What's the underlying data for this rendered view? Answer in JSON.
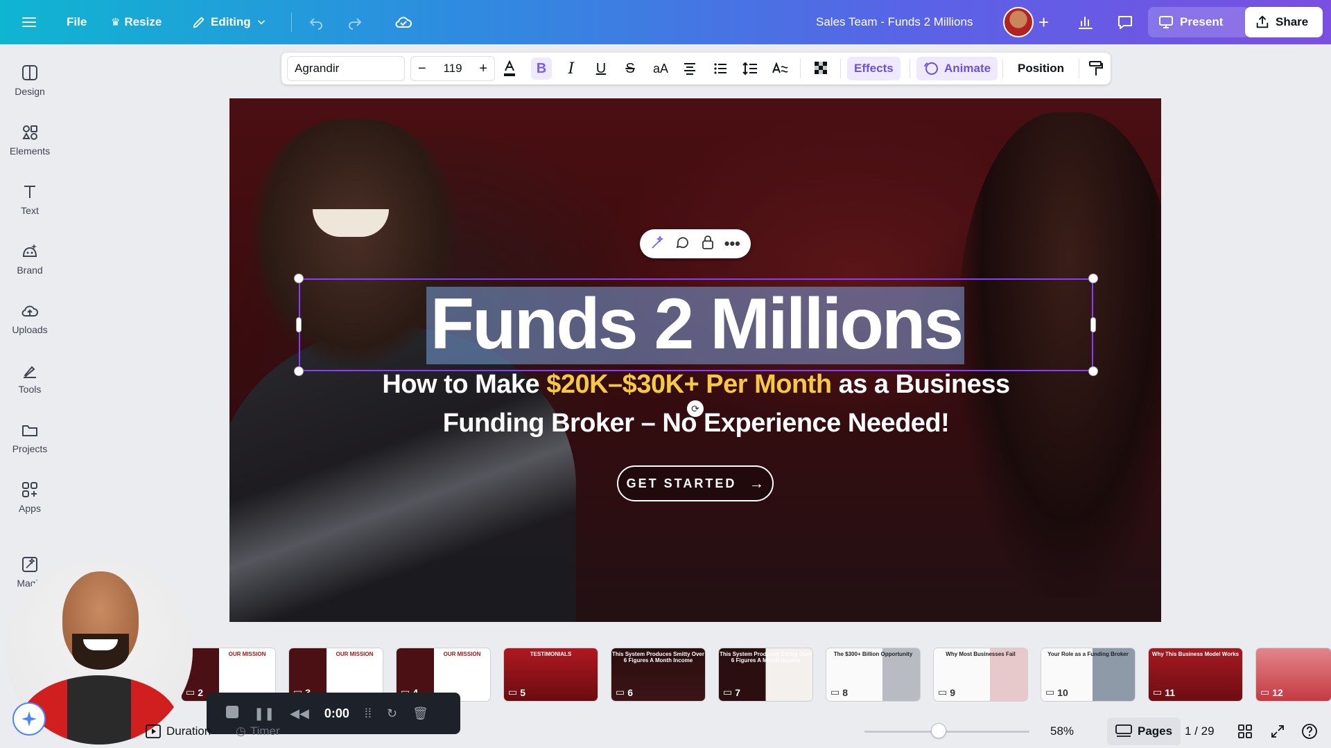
{
  "topbar": {
    "file_label": "File",
    "resize_label": "Resize",
    "editing_label": "Editing",
    "doc_title": "Sales Team - Funds 2 Millions",
    "present_label": "Present",
    "share_label": "Share"
  },
  "rail": {
    "items": [
      {
        "label": "Design",
        "icon": "design-icon"
      },
      {
        "label": "Elements",
        "icon": "elements-icon"
      },
      {
        "label": "Text",
        "icon": "text-icon"
      },
      {
        "label": "Brand",
        "icon": "brand-icon"
      },
      {
        "label": "Uploads",
        "icon": "uploads-icon"
      },
      {
        "label": "Tools",
        "icon": "tools-icon"
      },
      {
        "label": "Projects",
        "icon": "projects-icon"
      },
      {
        "label": "Apps",
        "icon": "apps-icon"
      },
      {
        "label": "Magic",
        "icon": "magic-icon"
      }
    ]
  },
  "format_toolbar": {
    "font_name": "Agrandir",
    "font_size": "119",
    "effects_label": "Effects",
    "animate_label": "Animate",
    "position_label": "Position"
  },
  "canvas": {
    "headline": "Funds 2 Millions",
    "sub_part1": "How to Make ",
    "sub_highlight": "$20K–$30K+ Per Month",
    "sub_part2": " as a Business",
    "sub_line2": "Funding Broker – No Experience Needed!",
    "cta_label": "GET STARTED"
  },
  "filmstrip": {
    "thumbs": [
      {
        "num": "2",
        "label": "OUR MISSION"
      },
      {
        "num": "3",
        "label": "OUR MISSION"
      },
      {
        "num": "4",
        "label": "OUR MISSION"
      },
      {
        "num": "5",
        "label": "TESTIMONIALS"
      },
      {
        "num": "6",
        "label": "This System Produces Smitty Over 6 Figures A Month Income"
      },
      {
        "num": "7",
        "label": "This System Produces Smitty Over 6 Figures A Month Income"
      },
      {
        "num": "8",
        "label": "The $300+ Billion Opportunity"
      },
      {
        "num": "9",
        "label": "Why Most Businesses Fail"
      },
      {
        "num": "10",
        "label": "Your Role as a Funding Broker"
      },
      {
        "num": "11",
        "label": "Why This Business Model Works"
      },
      {
        "num": "12",
        "label": ""
      }
    ]
  },
  "media": {
    "time": "0:00",
    "duration_label": "Duration",
    "timer_label": "Timer"
  },
  "bottom": {
    "zoom_value": 0.45,
    "zoom_label": "58%",
    "pages_label": "Pages",
    "page_counter": "1 / 29"
  }
}
